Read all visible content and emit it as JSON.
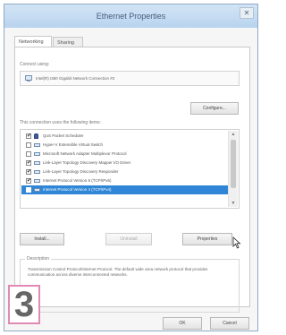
{
  "window": {
    "title": "Ethernet Properties",
    "close_symbol": "✕"
  },
  "tabs": [
    {
      "label": "Networking",
      "active": true
    },
    {
      "label": "Sharing",
      "active": false
    }
  ],
  "connect_using": {
    "label": "Connect using:",
    "adapter_name": "Intel(R) I350 Gigabit Network Connection #2",
    "configure_label": "Configure..."
  },
  "items_section": {
    "label": "This connection uses the following items:",
    "items": [
      {
        "checked": true,
        "icon": "user-group-icon",
        "text": "QoS Packet Scheduler",
        "selected": false
      },
      {
        "checked": false,
        "icon": "network-icon",
        "text": "Hyper-V Extensible Virtual Switch",
        "selected": false
      },
      {
        "checked": false,
        "icon": "network-icon",
        "text": "Microsoft Network Adapter Multiplexor Protocol",
        "selected": false
      },
      {
        "checked": true,
        "icon": "network-icon",
        "text": "Link-Layer Topology Discovery Mapper I/O Driver",
        "selected": false
      },
      {
        "checked": true,
        "icon": "network-icon",
        "text": "Link-Layer Topology Discovery Responder",
        "selected": false
      },
      {
        "checked": true,
        "icon": "network-icon",
        "text": "Internet Protocol Version 6 (TCP/IPv6)",
        "selected": false
      },
      {
        "checked": true,
        "icon": "network-icon",
        "text": "Internet Protocol Version 4 (TCP/IPv4)",
        "selected": true
      }
    ],
    "check_mark": "✔"
  },
  "buttons": {
    "install": "Install...",
    "uninstall": "Uninstall",
    "properties": "Properties",
    "ok": "OK",
    "cancel": "Cancel"
  },
  "description": {
    "label": "Description",
    "text": "Transmission Control Protocol/Internet Protocol. The default wide area network protocol that provides communication across diverse interconnected networks."
  },
  "step_badge": "3",
  "colors": {
    "selection": "#2f86d6",
    "badge_border": "#e08ab4",
    "titlebar": "#c6dcf2"
  }
}
